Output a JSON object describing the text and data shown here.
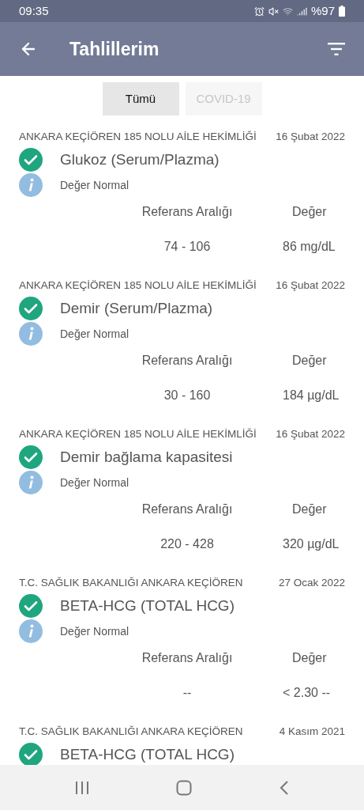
{
  "status_bar": {
    "time": "09:35",
    "battery": "%97"
  },
  "app_bar": {
    "title": "Tahlillerim"
  },
  "tabs": [
    {
      "label": "Tümü",
      "selected": true
    },
    {
      "label": "COVID-19",
      "selected": false
    }
  ],
  "results": [
    {
      "source": "ANKARA KEÇİÖREN 185 NOLU AİLE HEKİMLİĞİ",
      "date": "16 Şubat 2022",
      "test": "Glukoz (Serum/Plazma)",
      "note": "Değer Normal",
      "ref_label": "Referans Aralığı",
      "value_label": "Değer",
      "ref": "74 - 106",
      "value": "86 mg/dL"
    },
    {
      "source": "ANKARA KEÇİÖREN 185 NOLU AİLE HEKİMLİĞİ",
      "date": "16 Şubat 2022",
      "test": "Demir (Serum/Plazma)",
      "note": "Değer Normal",
      "ref_label": "Referans Aralığı",
      "value_label": "Değer",
      "ref": "30 - 160",
      "value": "184 µg/dL"
    },
    {
      "source": "ANKARA KEÇİÖREN 185 NOLU AİLE HEKİMLİĞİ",
      "date": "16 Şubat 2022",
      "test": "Demir bağlama kapasitesi",
      "note": "Değer Normal",
      "ref_label": "Referans Aralığı",
      "value_label": "Değer",
      "ref": "220 - 428",
      "value": "320 µg/dL"
    },
    {
      "source": "T.C. SAĞLIK BAKANLIĞI ANKARA KEÇİÖREN",
      "date": "27 Ocak 2022",
      "test": "BETA-HCG (TOTAL HCG)",
      "note": "Değer Normal",
      "ref_label": "Referans Aralığı",
      "value_label": "Değer",
      "ref": "--",
      "value": "< 2.30 --"
    },
    {
      "source": "T.C. SAĞLIK BAKANLIĞI ANKARA KEÇİÖREN",
      "date": "4 Kasım 2021",
      "test": "BETA-HCG (TOTAL HCG)"
    }
  ]
}
